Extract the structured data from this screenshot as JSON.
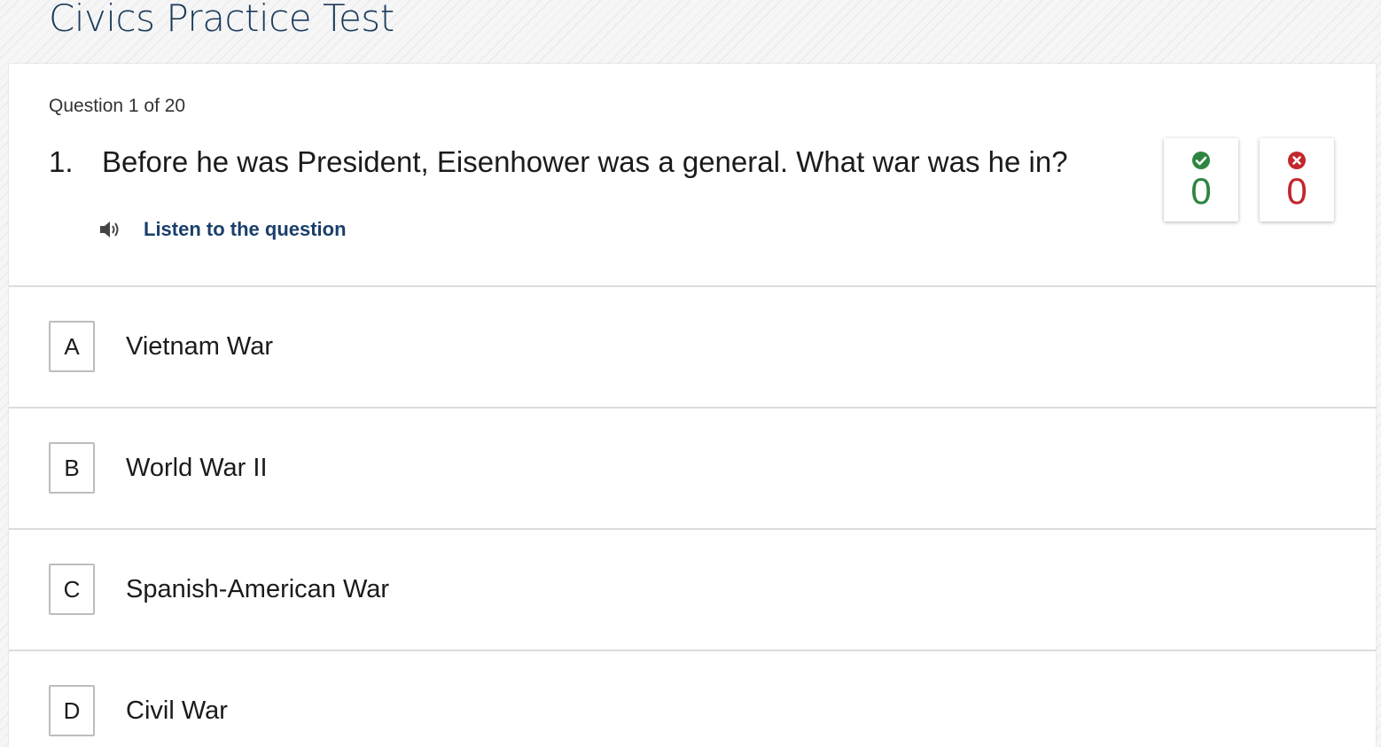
{
  "page": {
    "title": "Civics Practice Test"
  },
  "question": {
    "counter": "Question 1 of 20",
    "number": "1.",
    "text": "Before he was President, Eisenhower was a general. What war was he in?",
    "listen_label": "Listen to the question",
    "listen_icon": "speaker-icon"
  },
  "score": {
    "correct": {
      "icon": "check-circle-icon",
      "value": "0",
      "color": "#2e8540"
    },
    "incorrect": {
      "icon": "x-circle-icon",
      "value": "0",
      "color": "#c1272d"
    }
  },
  "answers": [
    {
      "letter": "A",
      "text": "Vietnam War"
    },
    {
      "letter": "B",
      "text": "World War II"
    },
    {
      "letter": "C",
      "text": "Spanish-American War"
    },
    {
      "letter": "D",
      "text": "Civil War"
    }
  ],
  "colors": {
    "title": "#1b3b5c",
    "link": "#1a3f6b",
    "border": "#dcdcdc"
  }
}
